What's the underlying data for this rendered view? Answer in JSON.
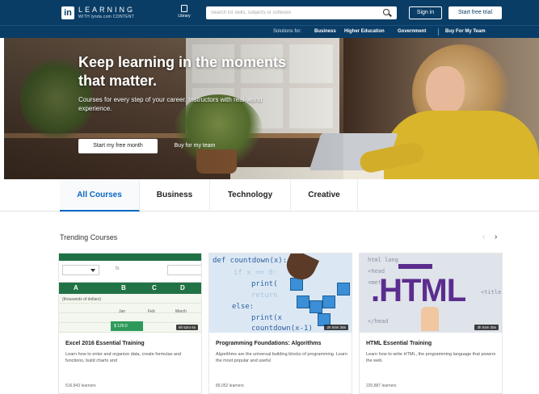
{
  "header": {
    "logo_badge": "in",
    "logo_text": "LEARNING",
    "logo_subtext": "WITH lynda.com CONTENT",
    "library_label": "Library",
    "search_placeholder": "Search for skills, subjects or software",
    "signin_label": "Sign in",
    "trial_label": "Start free trial"
  },
  "subnav": {
    "label": "Solutions for:",
    "items": [
      "Business",
      "Higher Education",
      "Government",
      "Buy For My Team"
    ]
  },
  "hero": {
    "title": "Keep learning in the moments that matter.",
    "subtitle": "Courses for every step of your career. Instructors with real-world experience.",
    "primary_button": "Start my free month",
    "secondary_button": "Buy for my team"
  },
  "tabs": [
    "All Courses",
    "Business",
    "Technology",
    "Creative"
  ],
  "active_tab": "All Courses",
  "trending": {
    "title": "Trending Courses",
    "prev_icon": "‹",
    "next_icon": "›"
  },
  "courses": [
    {
      "title": "Excel 2016 Essential Training",
      "description": "Learn how to enter and organize data, create formulas and functions, build charts and",
      "learners": "516,843 learners",
      "duration": "6h 52m 6s",
      "thumb": {
        "fx": "fx",
        "cols": [
          "A",
          "B",
          "C",
          "D"
        ],
        "row_label": "(thousands of dollars)",
        "months": [
          "Jan",
          "Feb",
          "March"
        ],
        "value_cell": "$ 120.0"
      }
    },
    {
      "title": "Programming Foundations: Algorithms",
      "description": "Algorithms are the universal building blocks of programming. Learn the most popular and useful",
      "learners": "89,052 learners",
      "duration": "2h 04m 38s",
      "thumb": {
        "line1": "def countdown(x):",
        "line2": "if x == 0:",
        "line3": "print(",
        "line4": "return",
        "line5": "else:",
        "line6": "print(x",
        "line7": "countdown(x-1)"
      }
    },
    {
      "title": "HTML Essential Training",
      "description": "Learn how to write HTML, the programming language that powers the web.",
      "learners": "220,887 learners",
      "duration": "3h 04m 35s",
      "thumb": {
        "big": ".HTML",
        "code1": "html lang",
        "code2": "<head",
        "code3": "<meta",
        "code4": "<title",
        "code5": "</head"
      }
    }
  ],
  "colors": {
    "brand_navy": "#0a3d66",
    "accent_blue": "#0a66c2",
    "excel_green": "#217346",
    "html_purple": "#5b2d8e"
  }
}
